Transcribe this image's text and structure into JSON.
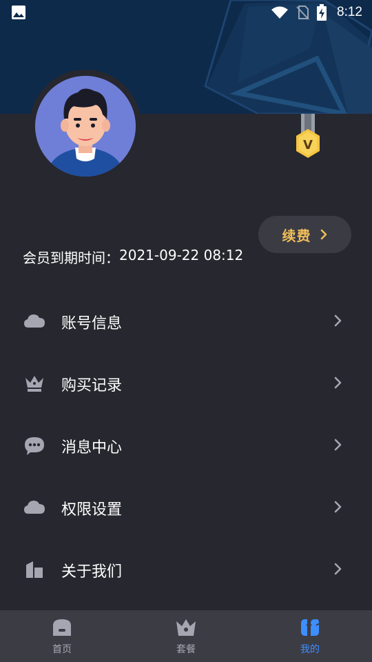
{
  "status_bar": {
    "time": "8:12",
    "icons": [
      "image-icon",
      "wifi-icon",
      "no-sim-icon",
      "battery-charging-icon"
    ]
  },
  "profile": {
    "avatar": "avatar-icon",
    "badge": "vip-medal-icon",
    "badge_letter": "V"
  },
  "membership": {
    "renew_label": "续费",
    "expiry_label": "会员到期时间：",
    "expiry_value": "2021-09-22 08:12"
  },
  "menu": {
    "items": [
      {
        "label": "账号信息",
        "icon": "cloud-icon"
      },
      {
        "label": "购买记录",
        "icon": "crown-icon"
      },
      {
        "label": "消息中心",
        "icon": "chat-bubble-icon"
      },
      {
        "label": "权限设置",
        "icon": "cloud-icon"
      },
      {
        "label": "关于我们",
        "icon": "book-icon"
      }
    ]
  },
  "tabbar": {
    "tabs": [
      {
        "label": "首页",
        "icon": "home-icon",
        "active": false
      },
      {
        "label": "套餐",
        "icon": "crown-icon",
        "active": false
      },
      {
        "label": "我的",
        "icon": "profile-icon",
        "active": true
      }
    ]
  },
  "colors": {
    "background": "#27272f",
    "header": "#0d2a4b",
    "accent_gold": "#f0be5a",
    "tab_active": "#3d8eff",
    "icon_gray": "#a6a6b2"
  }
}
